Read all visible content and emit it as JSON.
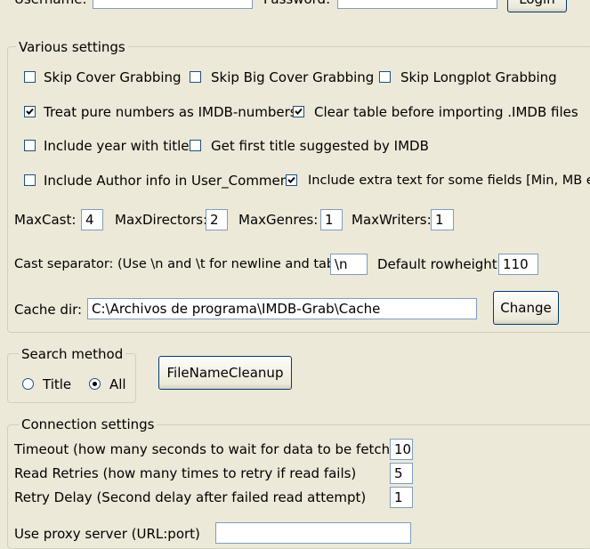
{
  "top": {
    "username_label": "Username:",
    "username_value": "",
    "password_label": "Password:",
    "password_value": "",
    "login_label": "Login"
  },
  "various": {
    "legend": "Various settings",
    "skip_cover": {
      "label": "Skip Cover Grabbing",
      "checked": false
    },
    "skip_big_cover": {
      "label": "Skip Big Cover Grabbing",
      "checked": false
    },
    "skip_longplot": {
      "label": "Skip Longplot Grabbing",
      "checked": false
    },
    "treat_numbers": {
      "label": "Treat pure numbers as IMDB-numbers",
      "checked": true
    },
    "clear_table": {
      "label": "Clear table before importing .IMDB files",
      "checked": true
    },
    "include_year": {
      "label": "Include year with title",
      "checked": false
    },
    "first_title": {
      "label": "Get first title suggested by IMDB",
      "checked": false
    },
    "author_info": {
      "label": "Include Author info in User_Comment",
      "checked": false
    },
    "extra_text": {
      "label": "Include extra text for some fields [Min, MB etc]",
      "checked": true
    },
    "maxcast_label": "MaxCast:",
    "maxcast_value": "4",
    "maxdirectors_label": "MaxDirectors:",
    "maxdirectors_value": "2",
    "maxgenres_label": "MaxGenres:",
    "maxgenres_value": "1",
    "maxwriters_label": "MaxWriters:",
    "maxwriters_value": "1",
    "cast_sep_label": "Cast separator: (Use \\n and \\t for newline and tab)",
    "cast_sep_value": "\\n",
    "rowheight_label": "Default rowheight:",
    "rowheight_value": "110",
    "cache_label": "Cache dir:",
    "cache_value": "C:\\Archivos de programa\\IMDB-Grab\\Cache",
    "change_label": "Change"
  },
  "search": {
    "legend": "Search method",
    "title_label": "Title",
    "title_selected": false,
    "all_label": "All",
    "all_selected": true
  },
  "filename_cleanup_label": "FileNameCleanup",
  "connection": {
    "legend": "Connection settings",
    "timeout_label": "Timeout (how many seconds to wait for data to be fetched)",
    "timeout_value": "10",
    "retries_label": "Read Retries (how many times to retry if read fails)",
    "retries_value": "5",
    "delay_label": "Retry Delay (Second delay after failed read attempt)",
    "delay_value": "1",
    "proxy_label": "Use proxy server (URL:port)",
    "proxy_value": ""
  },
  "icons": {
    "check": "check-mark-icon",
    "radio": "radio-dot-icon"
  }
}
